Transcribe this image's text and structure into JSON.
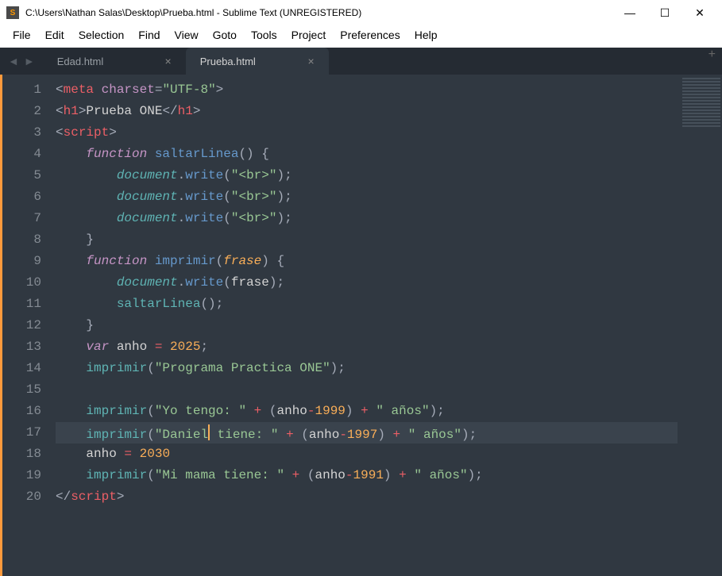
{
  "window": {
    "title": "C:\\Users\\Nathan Salas\\Desktop\\Prueba.html - Sublime Text (UNREGISTERED)",
    "app_icon": "S"
  },
  "menu": {
    "items": [
      "File",
      "Edit",
      "Selection",
      "Find",
      "View",
      "Goto",
      "Tools",
      "Project",
      "Preferences",
      "Help"
    ]
  },
  "tabs": {
    "items": [
      {
        "label": "Edad.html",
        "active": false
      },
      {
        "label": "Prueba.html",
        "active": true
      }
    ],
    "close_glyph": "×",
    "add_glyph": "+"
  },
  "code_lines": [
    [
      {
        "c": "punct",
        "t": "<"
      },
      {
        "c": "tag",
        "t": "meta"
      },
      {
        "c": "id",
        "t": " "
      },
      {
        "c": "attr",
        "t": "charset"
      },
      {
        "c": "punct",
        "t": "="
      },
      {
        "c": "str",
        "t": "\"UTF-8\""
      },
      {
        "c": "punct",
        "t": ">"
      }
    ],
    [
      {
        "c": "punct",
        "t": "<"
      },
      {
        "c": "tag",
        "t": "h1"
      },
      {
        "c": "punct",
        "t": ">"
      },
      {
        "c": "txt",
        "t": "Prueba ONE"
      },
      {
        "c": "punct",
        "t": "</"
      },
      {
        "c": "tag",
        "t": "h1"
      },
      {
        "c": "punct",
        "t": ">"
      }
    ],
    [
      {
        "c": "punct",
        "t": "<"
      },
      {
        "c": "tag",
        "t": "script"
      },
      {
        "c": "punct",
        "t": ">"
      }
    ],
    [
      {
        "c": "id",
        "t": "    "
      },
      {
        "c": "kw",
        "t": "function"
      },
      {
        "c": "id",
        "t": " "
      },
      {
        "c": "fn",
        "t": "saltarLinea"
      },
      {
        "c": "punct",
        "t": "() {"
      }
    ],
    [
      {
        "c": "id",
        "t": "        "
      },
      {
        "c": "obj",
        "t": "document"
      },
      {
        "c": "punct",
        "t": "."
      },
      {
        "c": "fn",
        "t": "write"
      },
      {
        "c": "punct",
        "t": "("
      },
      {
        "c": "str",
        "t": "\"<br>\""
      },
      {
        "c": "punct",
        "t": ");"
      }
    ],
    [
      {
        "c": "id",
        "t": "        "
      },
      {
        "c": "obj",
        "t": "document"
      },
      {
        "c": "punct",
        "t": "."
      },
      {
        "c": "fn",
        "t": "write"
      },
      {
        "c": "punct",
        "t": "("
      },
      {
        "c": "str",
        "t": "\"<br>\""
      },
      {
        "c": "punct",
        "t": ");"
      }
    ],
    [
      {
        "c": "id",
        "t": "        "
      },
      {
        "c": "obj",
        "t": "document"
      },
      {
        "c": "punct",
        "t": "."
      },
      {
        "c": "fn",
        "t": "write"
      },
      {
        "c": "punct",
        "t": "("
      },
      {
        "c": "str",
        "t": "\"<br>\""
      },
      {
        "c": "punct",
        "t": ");"
      }
    ],
    [
      {
        "c": "id",
        "t": "    "
      },
      {
        "c": "punct",
        "t": "}"
      }
    ],
    [
      {
        "c": "id",
        "t": "    "
      },
      {
        "c": "kw",
        "t": "function"
      },
      {
        "c": "id",
        "t": " "
      },
      {
        "c": "fn",
        "t": "imprimir"
      },
      {
        "c": "punct",
        "t": "("
      },
      {
        "c": "param",
        "t": "frase"
      },
      {
        "c": "punct",
        "t": ") {"
      }
    ],
    [
      {
        "c": "id",
        "t": "        "
      },
      {
        "c": "obj",
        "t": "document"
      },
      {
        "c": "punct",
        "t": "."
      },
      {
        "c": "fn",
        "t": "write"
      },
      {
        "c": "punct",
        "t": "("
      },
      {
        "c": "id",
        "t": "frase"
      },
      {
        "c": "punct",
        "t": ");"
      }
    ],
    [
      {
        "c": "id",
        "t": "        "
      },
      {
        "c": "fncall",
        "t": "saltarLinea"
      },
      {
        "c": "punct",
        "t": "();"
      }
    ],
    [
      {
        "c": "id",
        "t": "    "
      },
      {
        "c": "punct",
        "t": "}"
      }
    ],
    [
      {
        "c": "id",
        "t": "    "
      },
      {
        "c": "varkw",
        "t": "var"
      },
      {
        "c": "id",
        "t": " anho "
      },
      {
        "c": "op",
        "t": "="
      },
      {
        "c": "id",
        "t": " "
      },
      {
        "c": "num",
        "t": "2025"
      },
      {
        "c": "punct",
        "t": ";"
      }
    ],
    [
      {
        "c": "id",
        "t": "    "
      },
      {
        "c": "fncall",
        "t": "imprimir"
      },
      {
        "c": "punct",
        "t": "("
      },
      {
        "c": "str",
        "t": "\"Programa Practica ONE\""
      },
      {
        "c": "punct",
        "t": ");"
      }
    ],
    [],
    [
      {
        "c": "id",
        "t": "    "
      },
      {
        "c": "fncall",
        "t": "imprimir"
      },
      {
        "c": "punct",
        "t": "("
      },
      {
        "c": "str",
        "t": "\"Yo tengo: \""
      },
      {
        "c": "id",
        "t": " "
      },
      {
        "c": "op",
        "t": "+"
      },
      {
        "c": "id",
        "t": " "
      },
      {
        "c": "punct",
        "t": "("
      },
      {
        "c": "id",
        "t": "anho"
      },
      {
        "c": "op",
        "t": "-"
      },
      {
        "c": "num",
        "t": "1999"
      },
      {
        "c": "punct",
        "t": ")"
      },
      {
        "c": "id",
        "t": " "
      },
      {
        "c": "op",
        "t": "+"
      },
      {
        "c": "id",
        "t": " "
      },
      {
        "c": "str",
        "t": "\" años\""
      },
      {
        "c": "punct",
        "t": ");"
      }
    ],
    [
      {
        "c": "id",
        "t": "    "
      },
      {
        "c": "fncall",
        "t": "imprimir"
      },
      {
        "c": "punct",
        "t": "("
      },
      {
        "c": "str",
        "t": "\"Daniel"
      },
      {
        "cursor": true
      },
      {
        "c": "str",
        "t": " tiene: \""
      },
      {
        "c": "id",
        "t": " "
      },
      {
        "c": "op",
        "t": "+"
      },
      {
        "c": "id",
        "t": " "
      },
      {
        "c": "punct",
        "t": "("
      },
      {
        "c": "id",
        "t": "anho"
      },
      {
        "c": "op",
        "t": "-"
      },
      {
        "c": "num",
        "t": "1997"
      },
      {
        "c": "punct",
        "t": ")"
      },
      {
        "c": "id",
        "t": " "
      },
      {
        "c": "op",
        "t": "+"
      },
      {
        "c": "id",
        "t": " "
      },
      {
        "c": "str",
        "t": "\" años\""
      },
      {
        "c": "punct",
        "t": ");"
      }
    ],
    [
      {
        "c": "id",
        "t": "    anho "
      },
      {
        "c": "op",
        "t": "="
      },
      {
        "c": "id",
        "t": " "
      },
      {
        "c": "num",
        "t": "2030"
      }
    ],
    [
      {
        "c": "id",
        "t": "    "
      },
      {
        "c": "fncall",
        "t": "imprimir"
      },
      {
        "c": "punct",
        "t": "("
      },
      {
        "c": "str",
        "t": "\"Mi mama tiene: \""
      },
      {
        "c": "id",
        "t": " "
      },
      {
        "c": "op",
        "t": "+"
      },
      {
        "c": "id",
        "t": " "
      },
      {
        "c": "punct",
        "t": "("
      },
      {
        "c": "id",
        "t": "anho"
      },
      {
        "c": "op",
        "t": "-"
      },
      {
        "c": "num",
        "t": "1991"
      },
      {
        "c": "punct",
        "t": ")"
      },
      {
        "c": "id",
        "t": " "
      },
      {
        "c": "op",
        "t": "+"
      },
      {
        "c": "id",
        "t": " "
      },
      {
        "c": "str",
        "t": "\" años\""
      },
      {
        "c": "punct",
        "t": ");"
      }
    ],
    [
      {
        "c": "punct",
        "t": "</"
      },
      {
        "c": "tag",
        "t": "script"
      },
      {
        "c": "punct",
        "t": ">"
      }
    ]
  ],
  "current_line": 17
}
